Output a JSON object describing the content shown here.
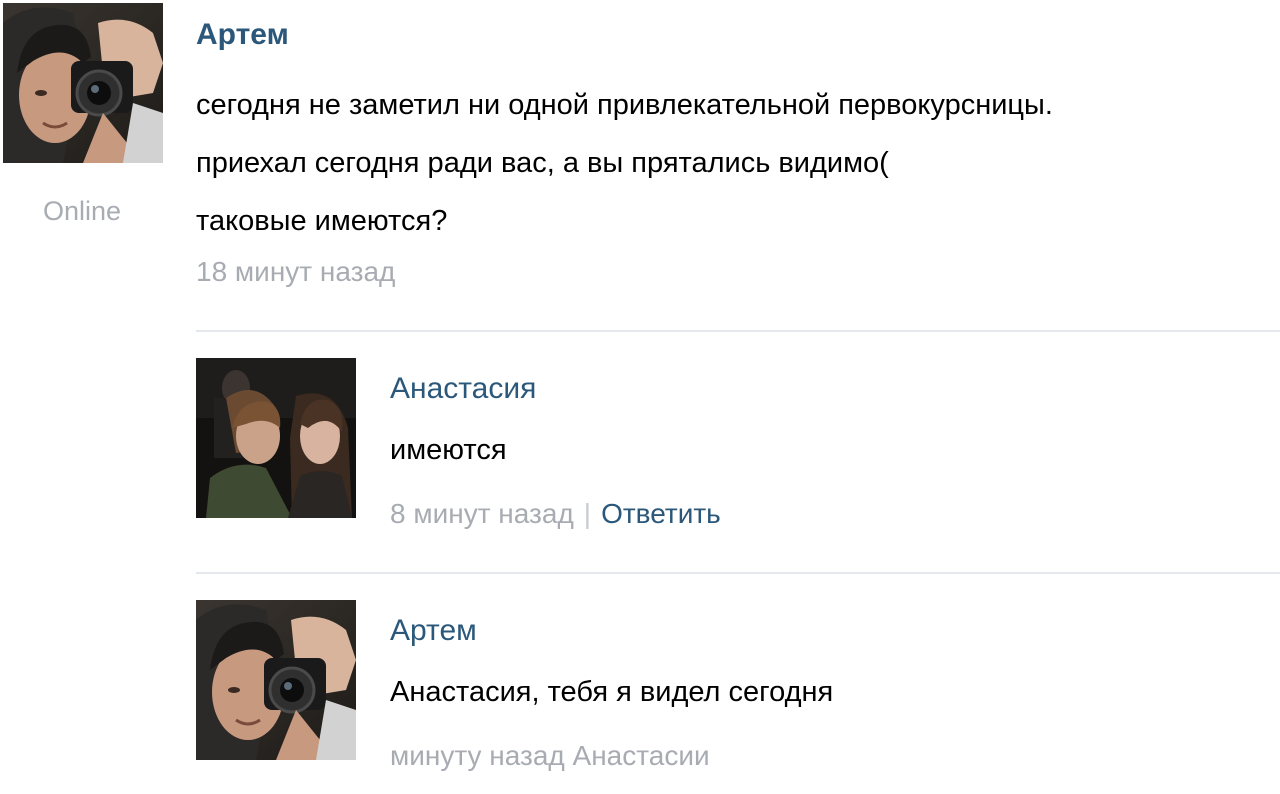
{
  "post": {
    "author": "Артем",
    "status": "Online",
    "text_lines": [
      "сегодня не заметил ни одной привлекательной первокурсницы.",
      "приехал сегодня ради вас, а вы прятались видимо(",
      "таковые имеются?"
    ],
    "time": "18 минут назад"
  },
  "comments": [
    {
      "author": "Анастасия",
      "text": "имеются",
      "time": "8 минут назад",
      "separator": "|",
      "reply_label": "Ответить"
    },
    {
      "author": "Артем",
      "text": "Анастасия, тебя я видел сегодня",
      "time": "минуту назад Анастасии"
    }
  ],
  "colors": {
    "author_link": "#2b587a",
    "meta_gray": "#a8acb2",
    "divider": "#e4e8ed"
  },
  "icons": {
    "post_avatar": "avatar-photo-man-with-camera",
    "comment_1_avatar": "avatar-photo-two-girls",
    "comment_2_avatar": "avatar-photo-man-with-camera"
  }
}
